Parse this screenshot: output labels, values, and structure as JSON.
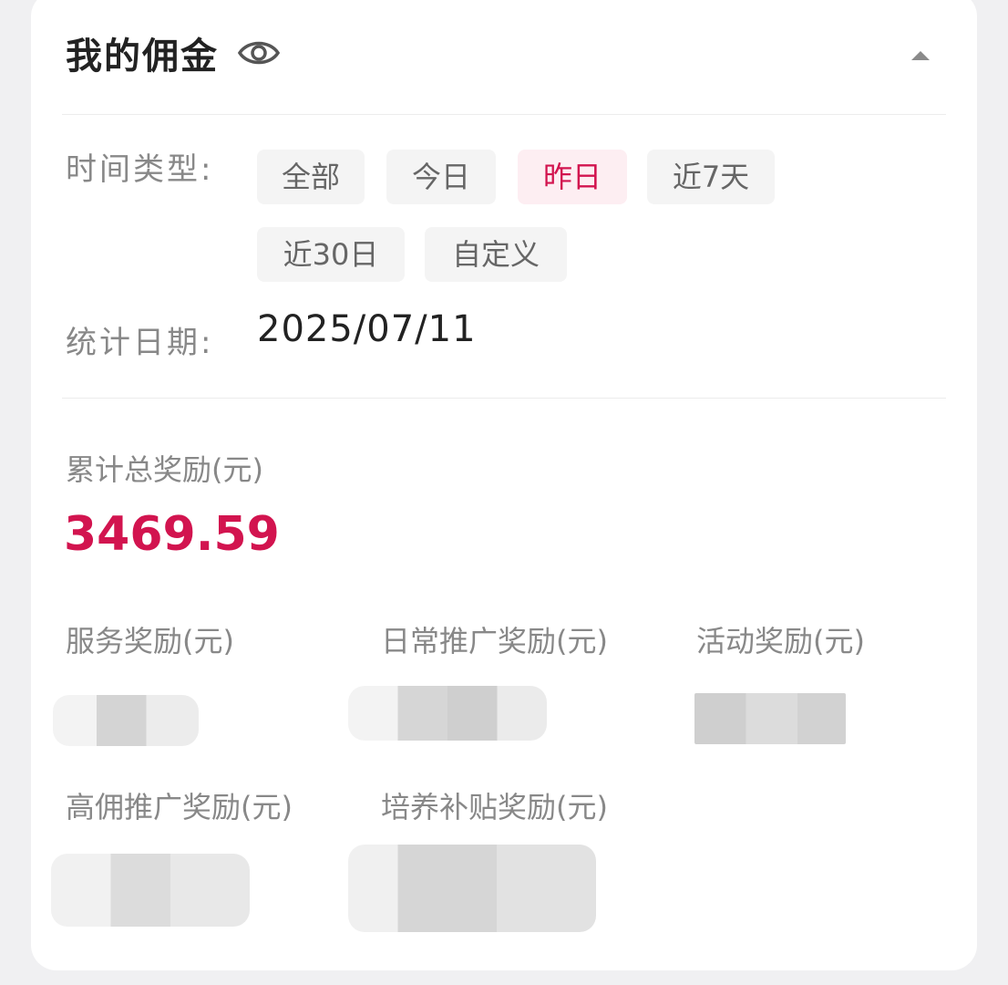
{
  "header": {
    "title": "我的佣金",
    "visibility_icon": "eye-icon",
    "collapse_icon": "caret-up-icon"
  },
  "filters": {
    "time_type_label": "时间类型:",
    "options": [
      "全部",
      "今日",
      "昨日",
      "近7天",
      "近30日",
      "自定义"
    ],
    "selected": "昨日",
    "date_label": "统计日期:",
    "date_value": "2025/07/11"
  },
  "summary": {
    "total_label": "累计总奖励(元)",
    "total_value": "3469.59"
  },
  "rewards": [
    {
      "label": "服务奖励(元)"
    },
    {
      "label": "日常推广奖励(元)"
    },
    {
      "label": "活动奖励(元)"
    },
    {
      "label": "高佣推广奖励(元)"
    },
    {
      "label": "培养补贴奖励(元)"
    }
  ],
  "colors": {
    "accent": "#d2144f",
    "active_chip_bg": "#fdeef2",
    "chip_bg": "#f4f4f4",
    "label_gray": "#888888"
  }
}
